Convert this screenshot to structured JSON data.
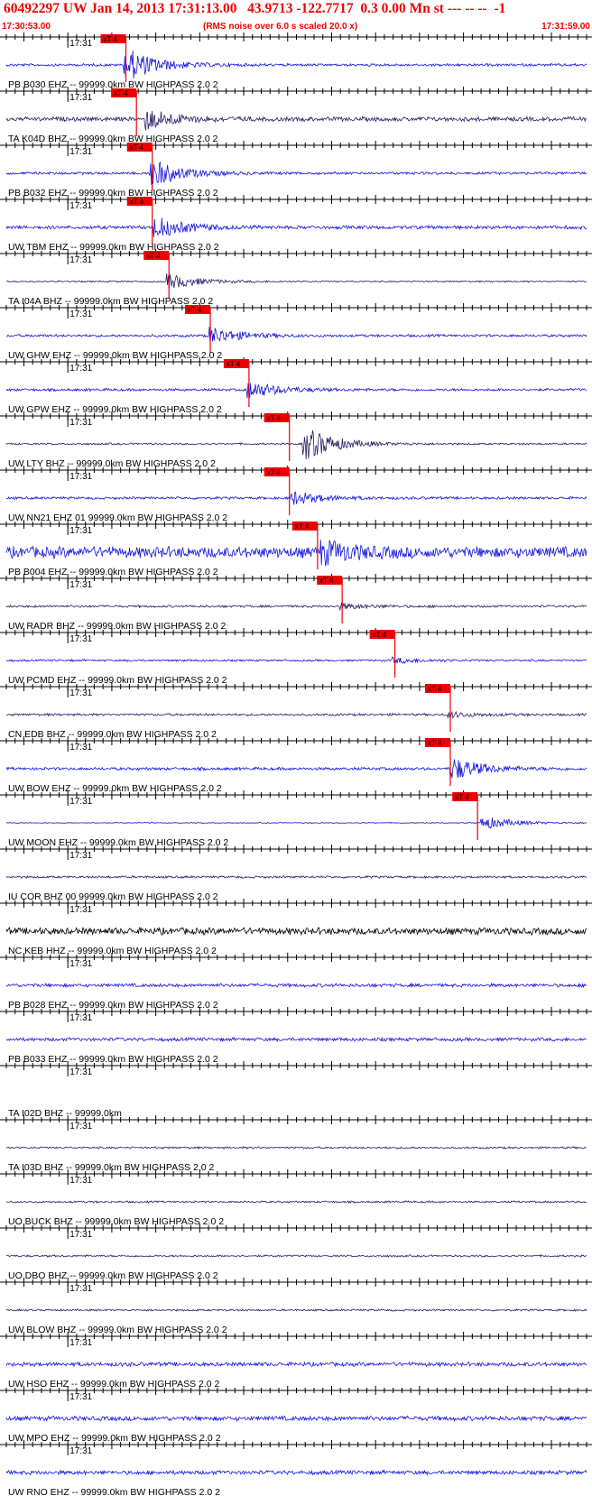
{
  "header": {
    "title": "60492297 UW Jan 14, 2013 17:31:13.00   43.9713 -122.7717  0.3 0.00 Mn st --- -- --  -1",
    "start_time": "17:30:53.00",
    "note": "(RMS noise over 6.0 s scaled 20.0 x)",
    "end_time": "17:31:59.00"
  },
  "chart_data": {
    "type": "line",
    "time_window": [
      "17:30:53.00",
      "17:31:59.00"
    ],
    "seconds_span": 66,
    "minute_label": "17:31",
    "minute_mark_s": 7,
    "pick_label": "xT 4",
    "colors": {
      "blue": "#1515e0",
      "dark": "#2b1f66",
      "black": "#000000",
      "red": "#ee0000"
    },
    "traces": [
      {
        "label": "PB B030 EHZ -- 99999.0km BW  HIGHPASS  2.0  2",
        "color": "blue",
        "amp": 9,
        "pick_s": 13.6,
        "burst_s": 13.6,
        "burst": 10,
        "bg": 0.3
      },
      {
        "label": "TA K04D BHZ -- 99999.0km BW  HIGHPASS  2.0  2",
        "color": "dark",
        "amp": 9,
        "pick_s": 14.8,
        "burst_s": 16,
        "burst": 6,
        "bg": 0.5
      },
      {
        "label": "PB B032 EHZ -- 99999.0km BW  HIGHPASS  2.0  2",
        "color": "blue",
        "amp": 9,
        "pick_s": 16.6,
        "burst_s": 16.6,
        "burst": 8,
        "bg": 0.3
      },
      {
        "label": "UW TBM EHZ -- 99999.0km BW  HIGHPASS  2.0  2",
        "color": "blue",
        "amp": 9,
        "pick_s": 16.6,
        "burst_s": 17,
        "burst": 6,
        "bg": 0.4
      },
      {
        "label": "TA I04A BHZ -- 99999.0km BW  HIGHPASS  2.0  2",
        "color": "dark",
        "amp": 8,
        "pick_s": 18.5,
        "burst_s": 18.5,
        "burst": 5,
        "bg": 0.2
      },
      {
        "label": "UW GHW EHZ -- 99999.0km BW  HIGHPASS  2.0  2",
        "color": "blue",
        "amp": 9,
        "pick_s": 23.2,
        "burst_s": 23.2,
        "burst": 5,
        "bg": 0.3
      },
      {
        "label": "UW GPW EHZ -- 99999.0km BW  HIGHPASS  2.0  2",
        "color": "blue",
        "amp": 9,
        "pick_s": 27.6,
        "burst_s": 27.6,
        "burst": 5,
        "bg": 0.3
      },
      {
        "label": "UW LTY BHZ -- 99999.0km BW  HIGHPASS  2.0  2",
        "color": "dark",
        "amp": 10,
        "pick_s": 32.2,
        "burst_s": 34,
        "burst": 9,
        "bg": 0.2
      },
      {
        "label": "UW NN21 EHZ 01 99999.0km BW  HIGHPASS  2.0  2",
        "color": "blue",
        "amp": 9,
        "pick_s": 32.2,
        "burst_s": 32.5,
        "burst": 4,
        "bg": 0.3
      },
      {
        "label": "PB B004 EHZ -- 99999.0km BW  HIGHPASS  2.0  2",
        "color": "blue",
        "amp": 13,
        "pick_s": 35.4,
        "burst_s": 36,
        "burst": 4,
        "bg": 0.9
      },
      {
        "label": "UW RADR BHZ -- 99999.0km BW  HIGHPASS  2.0  2",
        "color": "dark",
        "amp": 7,
        "pick_s": 38.2,
        "burst_s": 38.2,
        "burst": 2,
        "bg": 0.35
      },
      {
        "label": "UW PCMD EHZ -- 99999.0km BW  HIGHPASS  2.0  2",
        "color": "blue",
        "amp": 7,
        "pick_s": 44.2,
        "burst_s": 44.2,
        "burst": 2,
        "bg": 0.3
      },
      {
        "label": "CN EDB BHZ -- 99999.0km BW  HIGHPASS  2.0  2",
        "color": "dark",
        "amp": 7,
        "pick_s": 50.5,
        "burst_s": 50.5,
        "burst": 2,
        "bg": 0.35
      },
      {
        "label": "UW BOW EHZ -- 99999.0km BW  HIGHPASS  2.0  2",
        "color": "blue",
        "amp": 10,
        "pick_s": 50.5,
        "burst_s": 50.8,
        "burst": 6,
        "bg": 0.3
      },
      {
        "label": "UW MOON EHZ -- 99999.0km BW  HIGHPASS  2.0  2",
        "color": "blue",
        "amp": 9,
        "pick_s": 53.6,
        "burst_s": 54.2,
        "burst": 4,
        "bg": 0.1
      },
      {
        "label": "IU COR BHZ 00 99999.0km BW  HIGHPASS  2.0  2",
        "color": "dark",
        "amp": 6,
        "bg": 0.4
      },
      {
        "label": "NC KEB HHZ -- 99999.0km BW  HIGHPASS  2.0  2",
        "color": "black",
        "amp": 8,
        "bg": 0.9
      },
      {
        "label": "PB B028 EHZ -- 99999.0km BW  HIGHPASS  2.0  2",
        "color": "blue",
        "amp": 6,
        "bg": 0.6
      },
      {
        "label": "PB B033 EHZ -- 99999.0km BW  HIGHPASS  2.0  2",
        "color": "blue",
        "amp": 6,
        "bg": 0.6
      },
      {
        "label": "TA I02D BHZ -- 99999.0km",
        "color": "blue",
        "amp": 0,
        "bg": 0
      },
      {
        "label": "TA I03D BHZ -- 99999.0km BW  HIGHPASS  2.0  2",
        "color": "dark",
        "amp": 7,
        "bg": 0.3
      },
      {
        "label": "UO BUCK BHZ -- 99999.0km BW  HIGHPASS  2.0  2",
        "color": "dark",
        "amp": 5,
        "bg": 0.4
      },
      {
        "label": "UO DBO BHZ -- 99999.0km BW  HIGHPASS  2.0  2",
        "color": "dark",
        "amp": 5,
        "bg": 0.4
      },
      {
        "label": "UW BLOW BHZ -- 99999.0km BW  HIGHPASS  2.0  2",
        "color": "dark",
        "amp": 5,
        "bg": 0.4
      },
      {
        "label": "UW HSO EHZ -- 99999.0km BW  HIGHPASS  2.0  2",
        "color": "blue",
        "amp": 7,
        "bg": 0.6
      },
      {
        "label": "UW MPO EHZ -- 99999.0km BW  HIGHPASS  2.0  2",
        "color": "blue",
        "amp": 8,
        "bg": 0.6
      },
      {
        "label": "UW RNO EHZ -- 99999.0km BW  HIGHPASS  2.0  2",
        "color": "blue",
        "amp": 7,
        "bg": 0.6
      }
    ]
  }
}
